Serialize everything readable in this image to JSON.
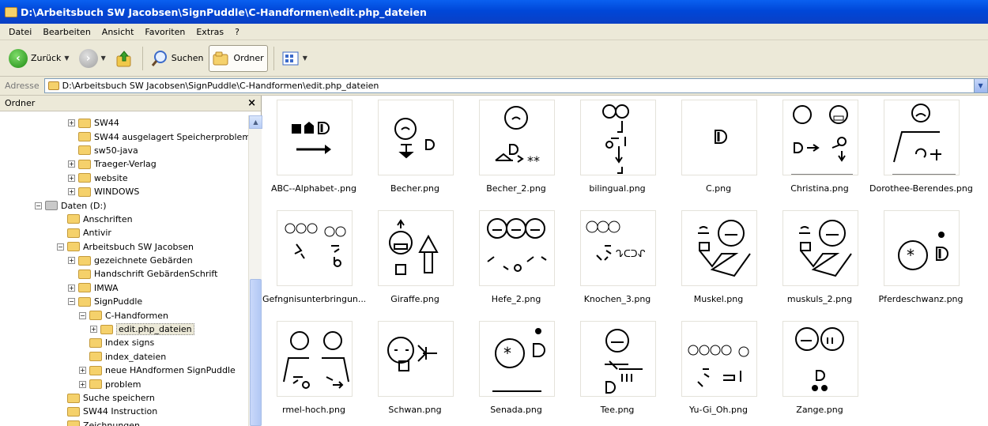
{
  "window": {
    "title": "D:\\Arbeitsbuch SW Jacobsen\\SignPuddle\\C-Handformen\\edit.php_dateien"
  },
  "menu": [
    "Datei",
    "Bearbeiten",
    "Ansicht",
    "Favoriten",
    "Extras",
    "?"
  ],
  "toolbar": {
    "back": "Zurück",
    "search": "Suchen",
    "folders": "Ordner"
  },
  "address": {
    "label": "Adresse",
    "value": "D:\\Arbeitsbuch SW Jacobsen\\SignPuddle\\C-Handformen\\edit.php_dateien"
  },
  "sidebar": {
    "title": "Ordner",
    "close": "×",
    "items": [
      {
        "label": "SW44",
        "expander": "+"
      },
      {
        "label": "SW44 ausgelagert Speicherproblem",
        "expander": ""
      },
      {
        "label": "sw50-java",
        "expander": ""
      },
      {
        "label": "Traeger-Verlag",
        "expander": "+"
      },
      {
        "label": "website",
        "expander": "+"
      },
      {
        "label": "WINDOWS",
        "expander": "+"
      },
      {
        "label": "Daten (D:)",
        "expander": "−"
      },
      {
        "label": "Anschriften",
        "expander": ""
      },
      {
        "label": "Antivir",
        "expander": ""
      },
      {
        "label": "Arbeitsbuch SW Jacobsen",
        "expander": "−"
      },
      {
        "label": "gezeichnete Gebärden",
        "expander": "+"
      },
      {
        "label": "Handschrift GebärdenSchrift",
        "expander": ""
      },
      {
        "label": "IMWA",
        "expander": "+"
      },
      {
        "label": "SignPuddle",
        "expander": "−"
      },
      {
        "label": "C-Handformen",
        "expander": "−"
      },
      {
        "label": "edit.php_dateien",
        "expander": "+"
      },
      {
        "label": "Index signs",
        "expander": ""
      },
      {
        "label": "index_dateien",
        "expander": ""
      },
      {
        "label": "neue HAndformen SignPuddle",
        "expander": "+"
      },
      {
        "label": "problem",
        "expander": "+"
      },
      {
        "label": "Suche speichern",
        "expander": ""
      },
      {
        "label": "SW44 Instruction",
        "expander": ""
      },
      {
        "label": "Zeichnungen",
        "expander": ""
      }
    ]
  },
  "files": [
    "ABC--Alphabet-.png",
    "Becher.png",
    "Becher_2.png",
    "bilingual.png",
    "C.png",
    "Christina.png",
    "Dorothee-Berendes.png",
    "Gefngnisunterbringun...",
    "Giraffe.png",
    "Hefe_2.png",
    "Knochen_3.png",
    "Muskel.png",
    "muskuls_2.png",
    "Pferdeschwanz.png",
    "rmel-hoch.png",
    "Schwan.png",
    "Senada.png",
    "Tee.png",
    "Yu-Gi_Oh.png",
    "Zange.png"
  ],
  "icons": {
    "up": "▲",
    "dropdown": "▼",
    "go": "→"
  }
}
